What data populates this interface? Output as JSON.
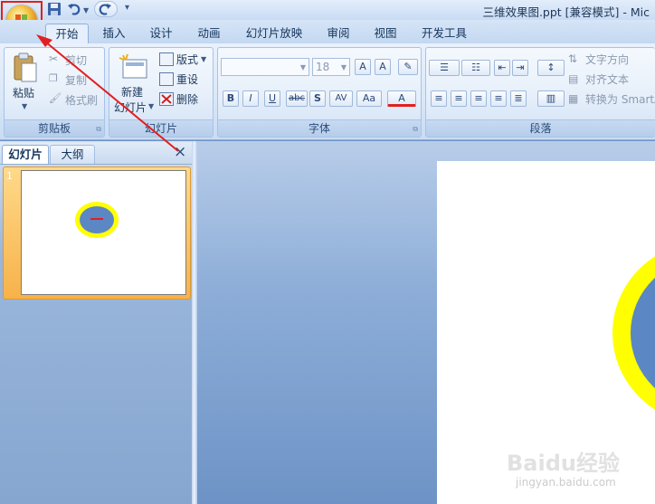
{
  "window": {
    "title": "三维效果图.ppt [兼容模式] - Mic"
  },
  "quick_access": {
    "save": "save-icon",
    "undo": "undo-icon",
    "redo": "redo-icon",
    "customize": "customize-icon"
  },
  "tabs": [
    {
      "label": "开始"
    },
    {
      "label": "插入"
    },
    {
      "label": "设计"
    },
    {
      "label": "动画"
    },
    {
      "label": "幻灯片放映"
    },
    {
      "label": "审阅"
    },
    {
      "label": "视图"
    },
    {
      "label": "开发工具"
    }
  ],
  "clipboard": {
    "paste": "粘贴",
    "cut": "剪切",
    "copy": "复制",
    "format_painter": "格式刷",
    "label": "剪贴板"
  },
  "slides_group": {
    "new_slide_line1": "新建",
    "new_slide_line2": "幻灯片",
    "layout": "版式",
    "reset": "重设",
    "delete": "删除",
    "label": "幻灯片"
  },
  "font_group": {
    "font_name": "",
    "font_size": "18",
    "label": "字体",
    "bold": "B",
    "italic": "I",
    "underline": "U",
    "strike": "abc",
    "shadow": "S",
    "spacing": "AV",
    "case": "Aa",
    "color": "A",
    "grow": "A",
    "shrink": "A"
  },
  "paragraph_group": {
    "text_direction": "文字方向",
    "align_text": "对齐文本",
    "smartart": "转换为 SmartArt",
    "label": "段落"
  },
  "pane": {
    "tab_slides": "幻灯片",
    "tab_outline": "大纲",
    "close": "×",
    "slide_number": "1"
  },
  "colors": {
    "accent_red": "#e02020",
    "ellipse_fill": "#5b87c4",
    "ellipse_ring": "#ffff00"
  },
  "watermark": {
    "brand": "Baidu经验",
    "url": "jingyan.baidu.com"
  }
}
